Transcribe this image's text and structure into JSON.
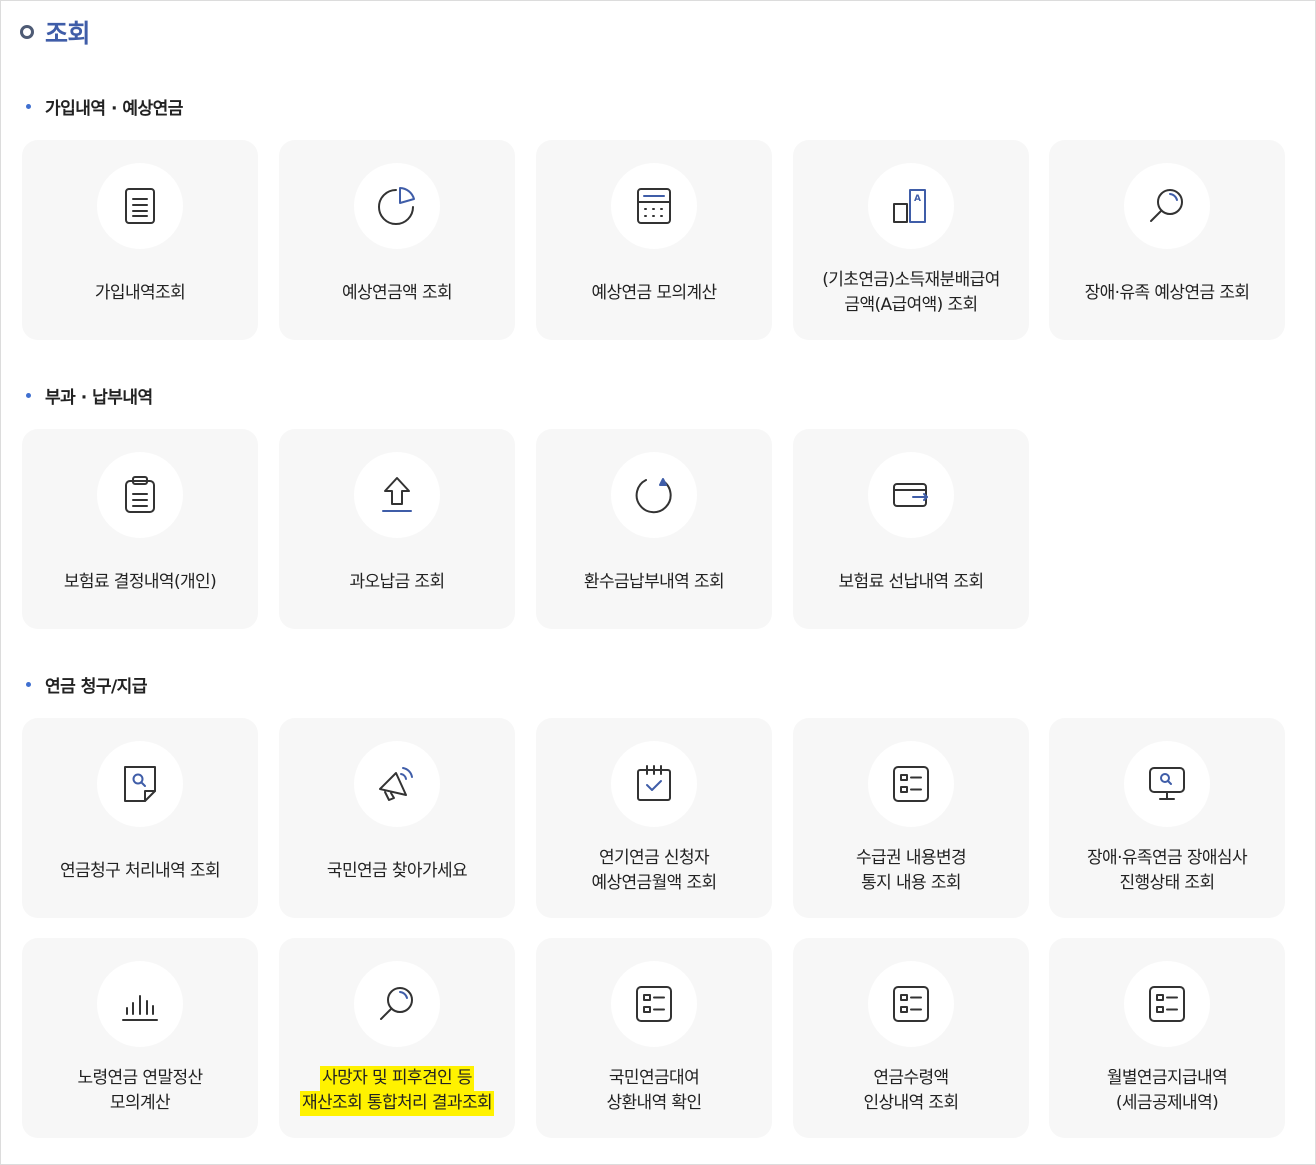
{
  "page": {
    "title": "조회"
  },
  "sections": [
    {
      "title": "가입내역 · 예상연금"
    },
    {
      "title": "부과 · 납부내역"
    },
    {
      "title": "연금 청구/지급"
    }
  ],
  "cards": [
    {
      "line1": "가입내역조회",
      "line2": "",
      "icon": "document-icon"
    },
    {
      "line1": "예상연금액 조회",
      "line2": "",
      "icon": "pie-chart-icon"
    },
    {
      "line1": "예상연금 모의계산",
      "line2": "",
      "icon": "calculator-icon"
    },
    {
      "line1": "(기초연금)소득재분배급여",
      "line2": "금액(A급여액) 조회",
      "icon": "a-value-bars-icon"
    },
    {
      "line1": "장애·유족 예상연금 조회",
      "line2": "",
      "icon": "magnifier-icon"
    },
    {
      "line1": "보험료 결정내역(개인)",
      "line2": "",
      "icon": "clipboard-icon"
    },
    {
      "line1": "과오납금 조회",
      "line2": "",
      "icon": "upload-arrow-icon"
    },
    {
      "line1": "환수금납부내역 조회",
      "line2": "",
      "icon": "refresh-circle-icon"
    },
    {
      "line1": "보험료 선납내역 조회",
      "line2": "",
      "icon": "wallet-icon"
    },
    {
      "line1": "연금청구 처리내역 조회",
      "line2": "",
      "icon": "document-search-icon"
    },
    {
      "line1": "국민연금 찾아가세요",
      "line2": "",
      "icon": "megaphone-icon"
    },
    {
      "line1": "연기연금 신청자",
      "line2": "예상연금월액 조회",
      "icon": "calendar-check-icon"
    },
    {
      "line1": "수급권 내용변경",
      "line2": "통지 내용 조회",
      "icon": "checklist-icon"
    },
    {
      "line1": "장애·유족연금 장애심사",
      "line2": "진행상태 조회",
      "icon": "monitor-search-icon"
    },
    {
      "line1": "노령연금 연말정산",
      "line2": "모의계산",
      "icon": "bar-chart-icon"
    },
    {
      "line1": "사망자 및 피후견인 등",
      "line2": "재산조회 통합처리 결과조회",
      "icon": "magnifier-icon",
      "highlight": "#fff200"
    },
    {
      "line1": "국민연금대여",
      "line2": "상환내역 확인",
      "icon": "checklist-icon"
    },
    {
      "line1": "연금수령액",
      "line2": "인상내역 조회",
      "icon": "checklist-icon"
    },
    {
      "line1": "월별연금지급내역",
      "line2": "(세금공제내역)",
      "icon": "checklist-icon"
    }
  ],
  "colors": {
    "title": "#3f5da8",
    "accent": "#3f6fd0",
    "icon_stroke": "#333333",
    "card_bg": "#f7f7f7"
  }
}
